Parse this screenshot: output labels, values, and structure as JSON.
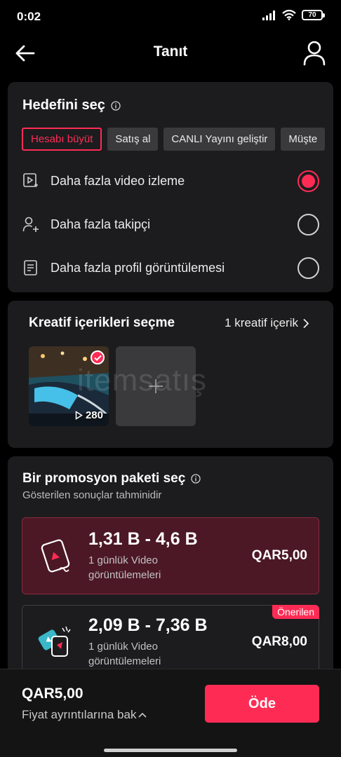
{
  "status": {
    "time": "0:02",
    "battery": "70"
  },
  "nav": {
    "title": "Tanıt",
    "back_icon": "arrow-left-icon",
    "profile_icon": "person-icon"
  },
  "goal": {
    "title": "Hedefini seç",
    "chips": [
      {
        "label": "Hesabı büyüt",
        "active": true
      },
      {
        "label": "Satış al",
        "active": false
      },
      {
        "label": "CANLI Yayını geliştir",
        "active": false
      },
      {
        "label": "Müşte",
        "active": false
      }
    ],
    "options": [
      {
        "label": "Daha fazla video izleme",
        "icon": "video-play-icon",
        "selected": true
      },
      {
        "label": "Daha fazla takipçi",
        "icon": "add-user-icon",
        "selected": false
      },
      {
        "label": "Daha fazla profil görüntülemesi",
        "icon": "profile-document-icon",
        "selected": false
      }
    ]
  },
  "creative": {
    "title": "Kreatif içerikleri seçme",
    "count_label": "1 kreatif içerik",
    "thumbnail": {
      "views": "280"
    }
  },
  "watermark": "itemsatış",
  "package": {
    "title": "Bir promosyon paketi seç",
    "subtitle": "Gösterilen sonuçlar tahminidir",
    "options": [
      {
        "range": "1,31 B - 4,6 B",
        "desc": "1 günlük Video görüntülemeleri",
        "price": "QAR5,00",
        "selected": true
      },
      {
        "range": "2,09 B - 7,36 B",
        "desc": "1 günlük Video görüntülemeleri",
        "price": "QAR8,00",
        "badge": "Önerilen",
        "selected": false
      }
    ]
  },
  "footer": {
    "total": "QAR5,00",
    "details_label": "Fiyat ayrıntılarına bak",
    "pay_label": "Öde"
  },
  "colors": {
    "accent": "#fe2c55",
    "card": "#1c1c1e",
    "selected_package": "#4c1825"
  }
}
